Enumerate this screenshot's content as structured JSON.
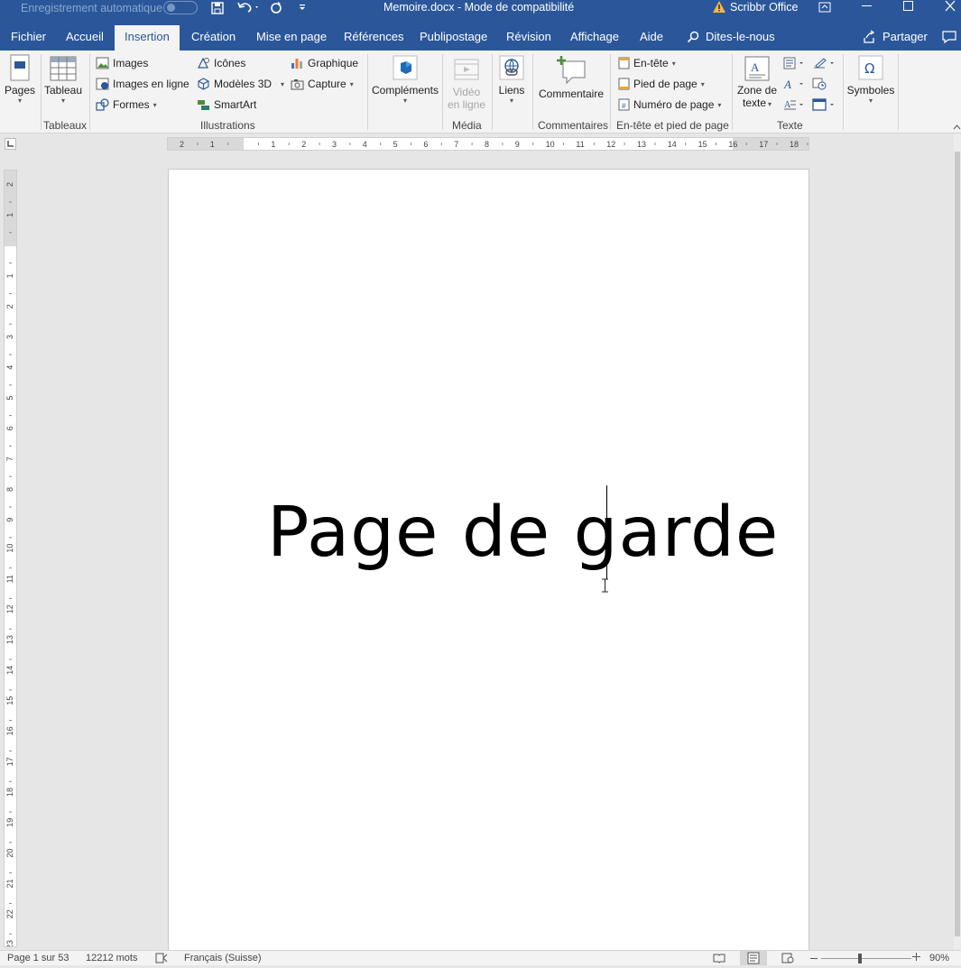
{
  "titlebar": {
    "autosave_label": "Enregistrement automatique",
    "document_title": "Memoire.docx  -  Mode de compatibilité",
    "addin_label": "Scribbr Office"
  },
  "tabs": [
    "Fichier",
    "Accueil",
    "Insertion",
    "Création",
    "Mise en page",
    "Références",
    "Publipostage",
    "Révision",
    "Affichage",
    "Aide"
  ],
  "tell_me": "Dites-le-nous",
  "share_label": "Partager",
  "ribbon": {
    "pages": "Pages",
    "tableau": "Tableau",
    "tableaux_group": "Tableaux",
    "images": "Images",
    "images_en_ligne": "Images en ligne",
    "formes": "Formes",
    "icones": "Icônes",
    "modeles_3d": "Modèles 3D",
    "smartart": "SmartArt",
    "graphique": "Graphique",
    "capture": "Capture",
    "illustrations_group": "Illustrations",
    "complements": "Compléments",
    "video_line1": "Vidéo",
    "video_line2": "en ligne",
    "media_group": "Média",
    "liens": "Liens",
    "commentaire": "Commentaire",
    "commentaires_group": "Commentaires",
    "en_tete": "En-tête",
    "pied_de_page": "Pied de page",
    "numero_de_page": "Numéro de page",
    "header_footer_group": "En-tête et pied de page",
    "zone_line1": "Zone de",
    "zone_line2": "texte",
    "texte_group": "Texte",
    "symboles": "Symboles"
  },
  "ruler_h": [
    "2",
    "1",
    "",
    "1",
    "2",
    "3",
    "4",
    "5",
    "6",
    "7",
    "8",
    "9",
    "10",
    "11",
    "12",
    "13",
    "14",
    "15",
    "16",
    "17",
    "18"
  ],
  "ruler_v": [
    "2",
    "1",
    "",
    "1",
    "2",
    "3",
    "4",
    "5",
    "6",
    "7",
    "8",
    "9",
    "10",
    "11",
    "12",
    "13",
    "14",
    "15",
    "16",
    "17",
    "18",
    "19",
    "20",
    "21",
    "22",
    "23"
  ],
  "document": {
    "heading": "Page de garde"
  },
  "statusbar": {
    "page_info": "Page 1 sur 53",
    "word_count": "12212 mots",
    "language": "Français (Suisse)",
    "zoom": "90%"
  },
  "colors": {
    "accent": "#2b579a",
    "ribbon_bg": "#f3f3f3",
    "canvas_bg": "#e6e6e6"
  }
}
